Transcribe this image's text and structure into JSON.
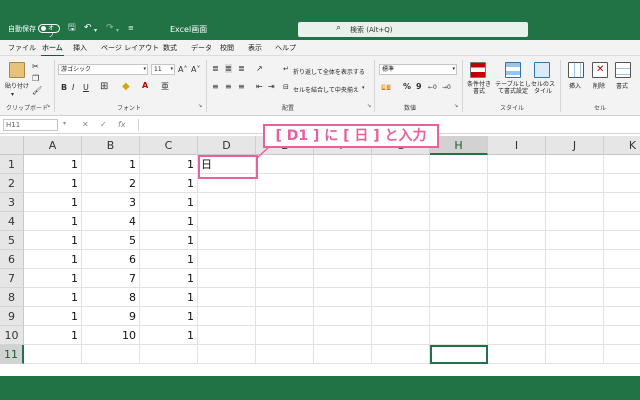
{
  "titlebar": {
    "autosave_label": "自動保存",
    "autosave_state": "オフ",
    "workbook_title": "Excel画面",
    "search_placeholder": "検索 (Alt+Q)"
  },
  "menu": {
    "tabs": [
      "ファイル",
      "ホーム",
      "挿入",
      "ページ レイアウト",
      "数式",
      "データ",
      "校閲",
      "表示",
      "ヘルプ"
    ],
    "active": "ホーム"
  },
  "ribbon": {
    "clipboard": {
      "paste_label": "貼り付け",
      "group_label": "クリップボード"
    },
    "font": {
      "font_name": "游ゴシック",
      "font_size": "11",
      "group_label": "フォント"
    },
    "alignment": {
      "wrap_text": "折り返して全体を表示する",
      "merge_center": "セルを結合して中央揃え",
      "group_label": "配置"
    },
    "number": {
      "format": "標準",
      "group_label": "数値"
    },
    "styles": {
      "conditional": "条件付き書式",
      "table": "テーブルとして書式設定",
      "cell_styles": "セルのスタイル",
      "group_label": "スタイル"
    },
    "cells": {
      "insert": "挿入",
      "delete": "削除",
      "format": "書式",
      "group_label": "セル"
    }
  },
  "formula_bar": {
    "name_box": "H11",
    "fx": "fx"
  },
  "grid": {
    "columns": [
      "A",
      "B",
      "C",
      "D",
      "E",
      "F",
      "G",
      "H",
      "I",
      "J",
      "K"
    ],
    "selected_column": "H",
    "selected_row": "11",
    "rows": [
      {
        "row": "1",
        "A": "1",
        "B": "1",
        "C": "1",
        "D": "日"
      },
      {
        "row": "2",
        "A": "1",
        "B": "2",
        "C": "1"
      },
      {
        "row": "3",
        "A": "1",
        "B": "3",
        "C": "1"
      },
      {
        "row": "4",
        "A": "1",
        "B": "4",
        "C": "1"
      },
      {
        "row": "5",
        "A": "1",
        "B": "5",
        "C": "1"
      },
      {
        "row": "6",
        "A": "1",
        "B": "6",
        "C": "1"
      },
      {
        "row": "7",
        "A": "1",
        "B": "7",
        "C": "1"
      },
      {
        "row": "8",
        "A": "1",
        "B": "8",
        "C": "1"
      },
      {
        "row": "9",
        "A": "1",
        "B": "9",
        "C": "1"
      },
      {
        "row": "10",
        "A": "1",
        "B": "10",
        "C": "1"
      },
      {
        "row": "11"
      }
    ]
  },
  "annotation": {
    "text": "[ D1 ] に [ 日 ] と入力",
    "color": "#e8609e"
  },
  "colors": {
    "brand": "#217346"
  }
}
